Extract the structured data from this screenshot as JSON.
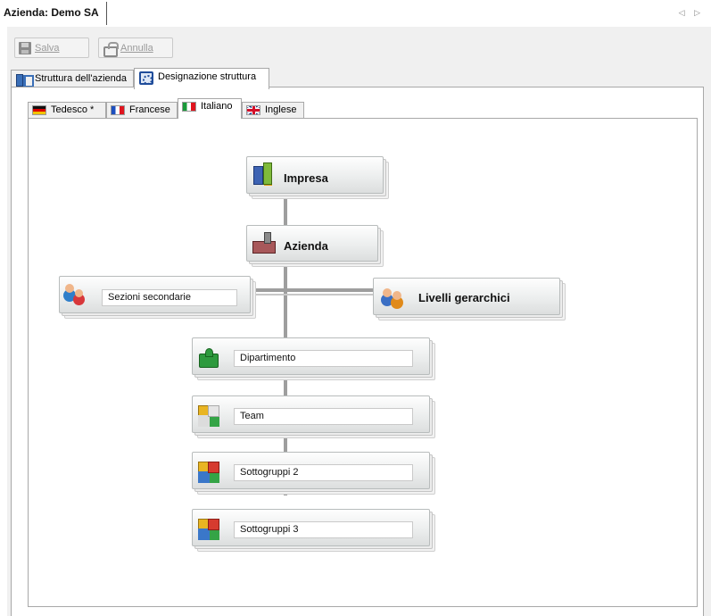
{
  "document": {
    "tab_title": "Azienda: Demo SA",
    "nav_arrows": "◁ ▷"
  },
  "toolbar": {
    "save_label": "Salva",
    "cancel_label": "Annulla"
  },
  "outer_tabs": [
    {
      "label": "Struttura dell'azienda",
      "icon": "structure-icon",
      "active": false
    },
    {
      "label": "Designazione struttura",
      "icon": "gear-settings-icon",
      "active": true
    }
  ],
  "language_tabs": [
    {
      "label": "Tedesco *",
      "flag": "germany-flag-icon",
      "active": false
    },
    {
      "label": "Francese",
      "flag": "france-flag-icon",
      "active": false
    },
    {
      "label": "Italiano",
      "flag": "italy-flag-icon",
      "active": true
    },
    {
      "label": "Inglese",
      "flag": "uk-flag-icon",
      "active": false
    }
  ],
  "structure": {
    "impresa": {
      "label": "Impresa",
      "icon": "building-icon"
    },
    "azienda": {
      "label": "Azienda",
      "icon": "factory-icon"
    },
    "sezioni_secondarie": {
      "value": "Sezioni secondarie",
      "icon": "people-icon"
    },
    "livelli_gerarchici": {
      "label": "Livelli gerarchici",
      "icon": "people-hierarchy-icon"
    },
    "levels": [
      {
        "value": "Dipartimento",
        "icon": "puzzle-piece-icon"
      },
      {
        "value": "Team",
        "icon": "puzzle-two-icon"
      },
      {
        "value": "Sottogruppi 2",
        "icon": "puzzle-four-icon"
      },
      {
        "value": "Sottogruppi 3",
        "icon": "puzzle-four-icon"
      }
    ]
  }
}
